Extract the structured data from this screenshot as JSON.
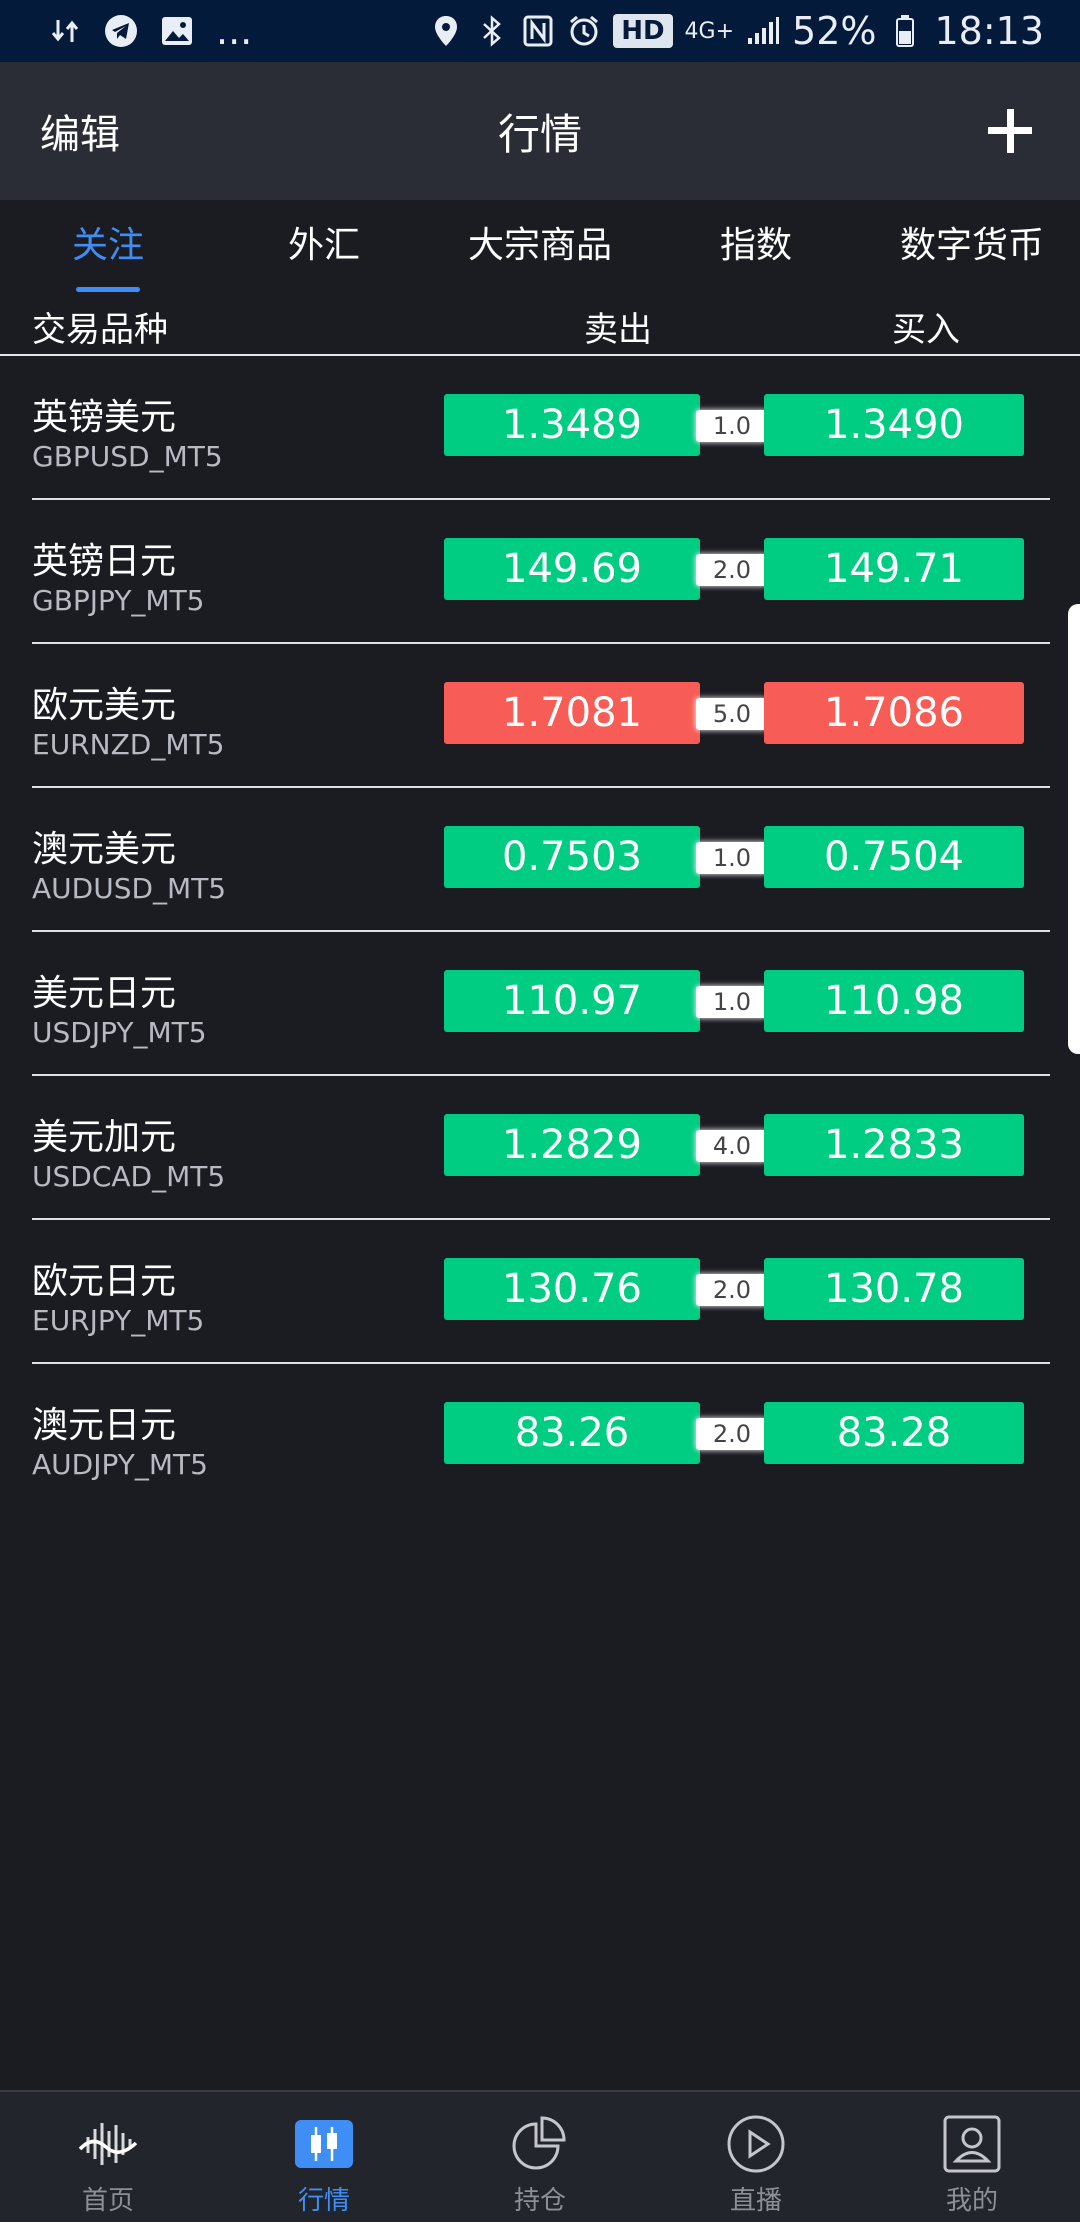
{
  "status_bar": {
    "left_icons": [
      "download-upload-icon",
      "telegram-icon",
      "image-icon"
    ],
    "more": "...",
    "hd": "HD",
    "network": "4G+",
    "battery": "52%",
    "time": "18:13"
  },
  "nav": {
    "edit": "编辑",
    "title": "行情",
    "add": "add-icon"
  },
  "tabs": [
    {
      "label": "关注",
      "active": true
    },
    {
      "label": "外汇",
      "active": false
    },
    {
      "label": "大宗商品",
      "active": false
    },
    {
      "label": "指数",
      "active": false
    },
    {
      "label": "数字货币",
      "active": false
    }
  ],
  "columns": {
    "symbol": "交易品种",
    "sell": "卖出",
    "buy": "买入"
  },
  "colors": {
    "up": "#00cc82",
    "down": "#f75d56",
    "accent": "#3f8ef5"
  },
  "rows": [
    {
      "name_cn": "英镑美元",
      "code": "GBPUSD_MT5",
      "sell": "1.3489",
      "spread": "1.0",
      "buy": "1.3490",
      "trend": "up"
    },
    {
      "name_cn": "英镑日元",
      "code": "GBPJPY_MT5",
      "sell": "149.69",
      "spread": "2.0",
      "buy": "149.71",
      "trend": "up"
    },
    {
      "name_cn": "欧元美元",
      "code": "EURNZD_MT5",
      "sell": "1.7081",
      "spread": "5.0",
      "buy": "1.7086",
      "trend": "down"
    },
    {
      "name_cn": "澳元美元",
      "code": "AUDUSD_MT5",
      "sell": "0.7503",
      "spread": "1.0",
      "buy": "0.7504",
      "trend": "up"
    },
    {
      "name_cn": "美元日元",
      "code": "USDJPY_MT5",
      "sell": "110.97",
      "spread": "1.0",
      "buy": "110.98",
      "trend": "up"
    },
    {
      "name_cn": "美元加元",
      "code": "USDCAD_MT5",
      "sell": "1.2829",
      "spread": "4.0",
      "buy": "1.2833",
      "trend": "up"
    },
    {
      "name_cn": "欧元日元",
      "code": "EURJPY_MT5",
      "sell": "130.76",
      "spread": "2.0",
      "buy": "130.78",
      "trend": "up"
    },
    {
      "name_cn": "澳元日元",
      "code": "AUDJPY_MT5",
      "sell": "83.26",
      "spread": "2.0",
      "buy": "83.28",
      "trend": "up"
    }
  ],
  "bottom_nav": [
    {
      "label": "首页",
      "icon": "wave-icon",
      "active": false
    },
    {
      "label": "行情",
      "icon": "candlestick-icon",
      "active": true
    },
    {
      "label": "持仓",
      "icon": "pie-chart-icon",
      "active": false
    },
    {
      "label": "直播",
      "icon": "play-icon",
      "active": false
    },
    {
      "label": "我的",
      "icon": "user-icon",
      "active": false
    }
  ]
}
